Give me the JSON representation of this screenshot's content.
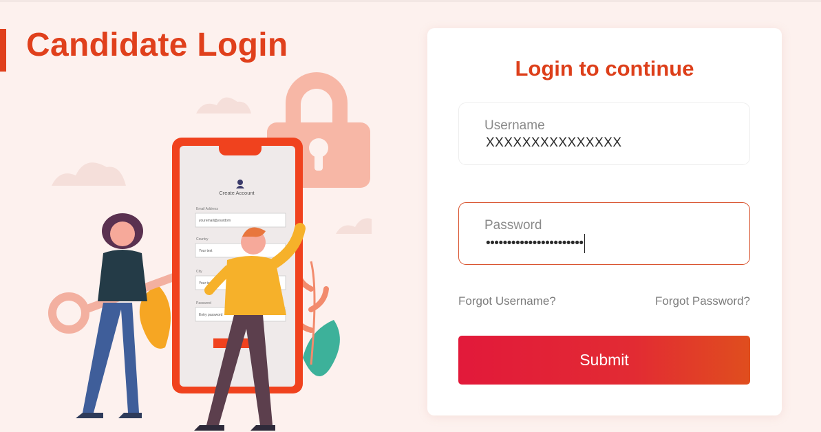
{
  "page": {
    "title": "Candidate Login"
  },
  "illustration": {
    "phone_heading": "Create Account",
    "phone_labels": [
      "Email Address",
      "Country",
      "City",
      "Password"
    ],
    "phone_values": [
      "youremail@yourdom",
      "Your text",
      "Your te",
      "Entry password"
    ]
  },
  "login_card": {
    "heading": "Login to continue",
    "username": {
      "label": "Username",
      "value": "XXXXXXXXXXXXXXX"
    },
    "password": {
      "label": "Password",
      "value": "•••••••••••••••••••••••"
    },
    "forgot_username": "Forgot Username?",
    "forgot_password": "Forgot Password?",
    "submit_label": "Submit"
  },
  "colors": {
    "accent": "#e0401c",
    "submit_gradient": [
      "#e2193a",
      "#e04e1e"
    ],
    "background": "#fdf1ee"
  }
}
